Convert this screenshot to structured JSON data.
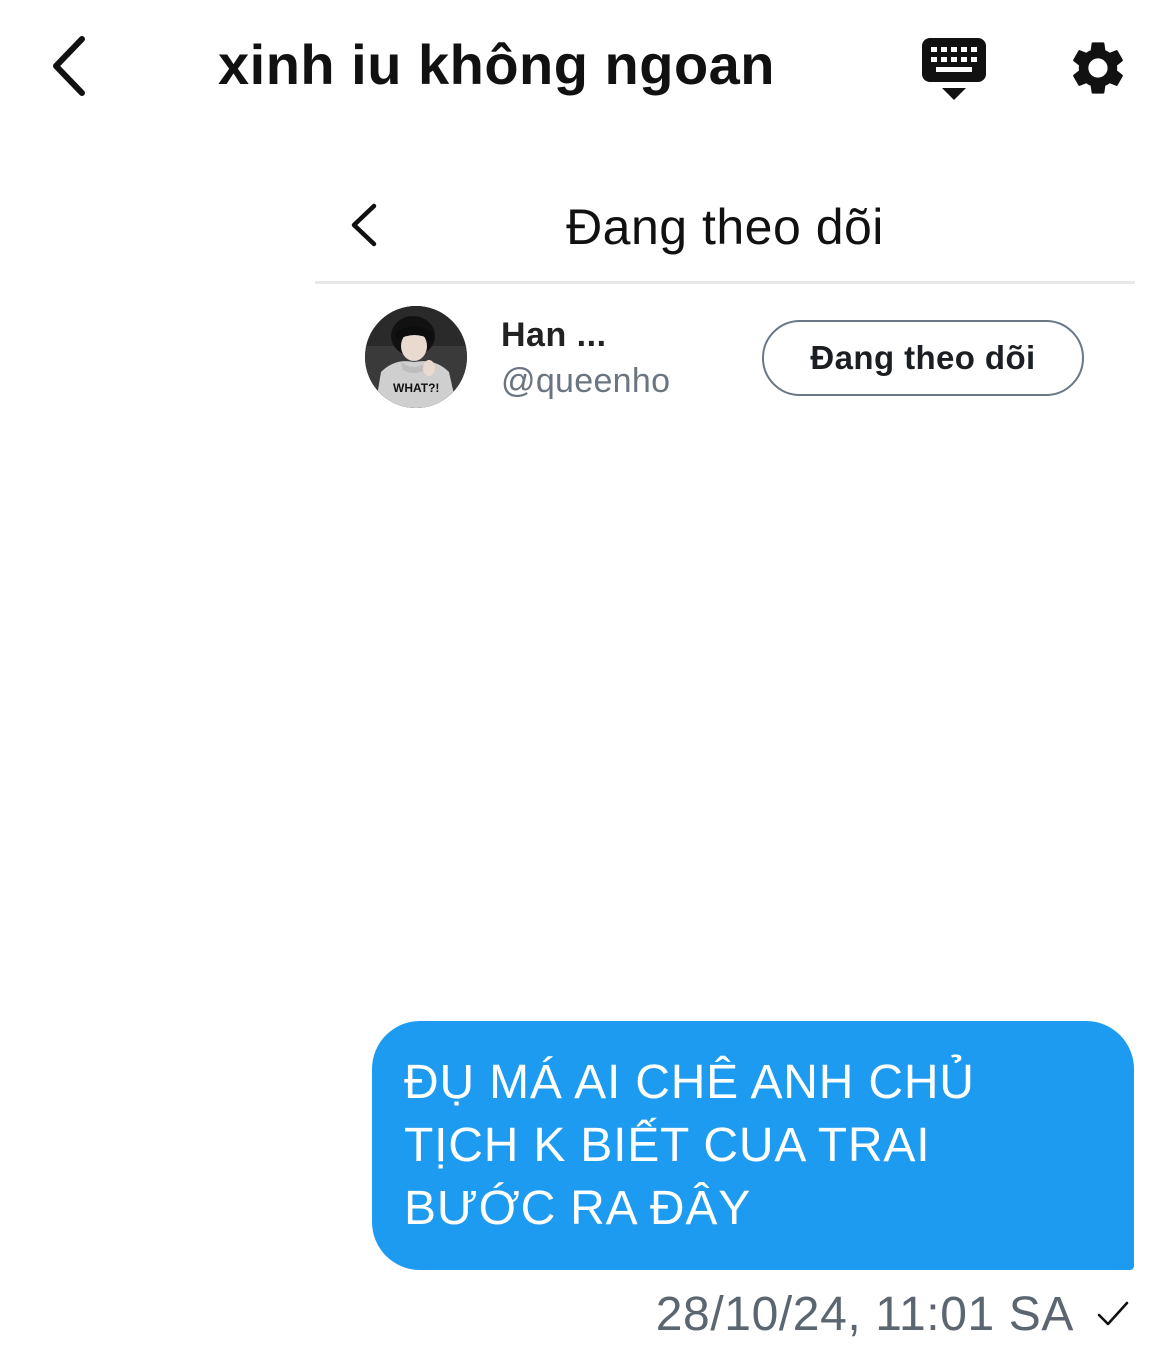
{
  "header": {
    "title": "xinh iu không ngoan",
    "back_icon": "chevron-left-icon",
    "keyboard_icon": "keyboard-icon",
    "settings_icon": "gear-icon"
  },
  "shared_card": {
    "title": "Đang theo dõi",
    "back_icon": "chevron-left-icon",
    "user": {
      "name": "Han ...",
      "handle": "@queenho",
      "avatar_shirt_text": "WHAT?!"
    },
    "follow_button_label": "Đang theo dõi"
  },
  "message": {
    "text": "ĐỤ MÁ AI CHÊ ANH CHỦ\nTỊCH K BIẾT CUA TRAI\nBƯỚC RA ĐÂY",
    "timestamp": "28/10/24, 11:01 SA",
    "status_icon": "checkmark-icon"
  },
  "colors": {
    "bubble": "#1d9bf0",
    "bubble_text": "#ffffff",
    "muted_text": "#5c6670",
    "button_border": "#6a7785"
  }
}
